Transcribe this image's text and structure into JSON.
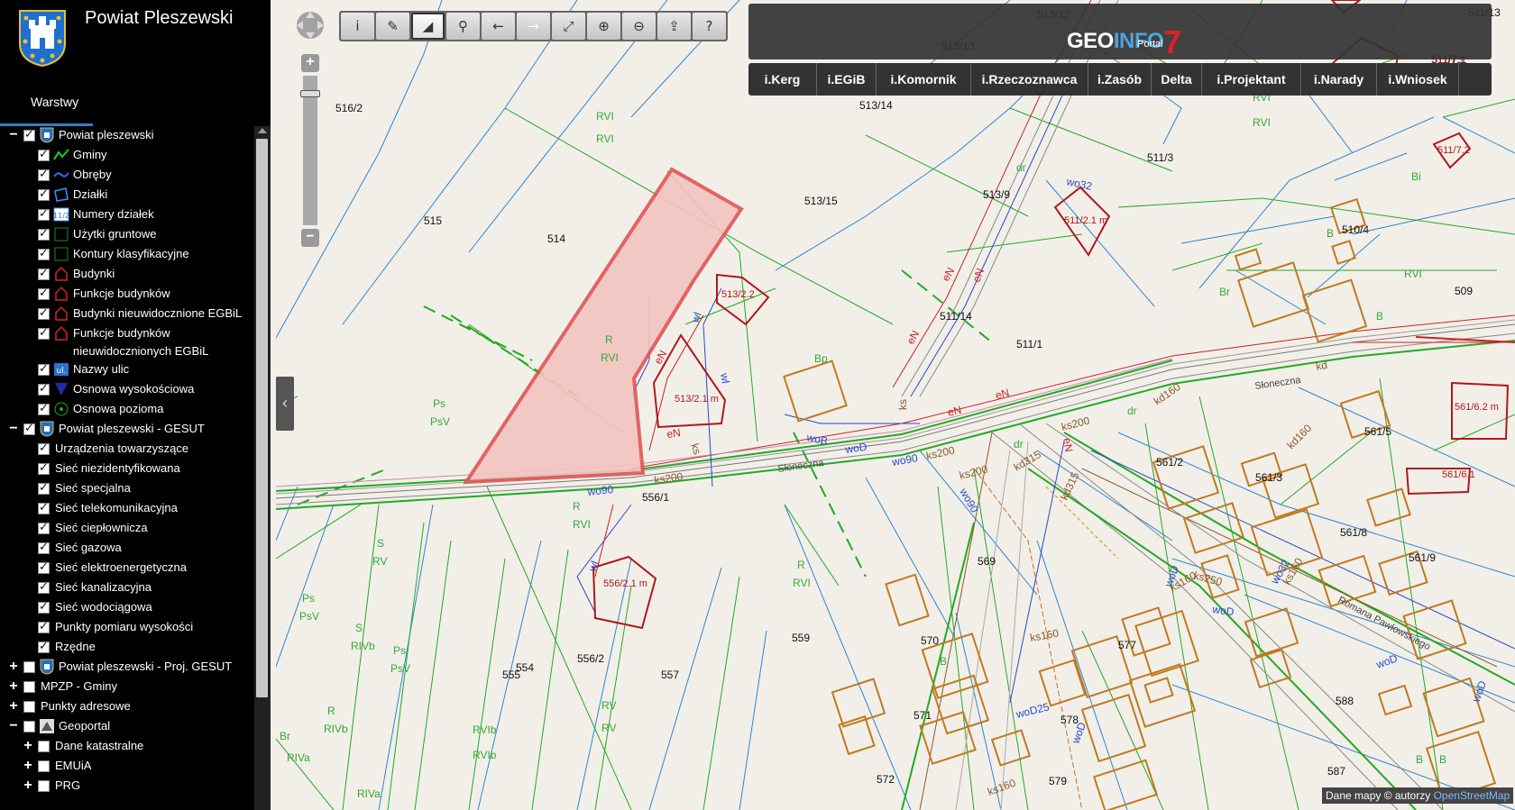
{
  "app": {
    "title": "Powiat Pleszewski"
  },
  "sidebar": {
    "tab_label": "Warstwy",
    "layers": [
      {
        "label": "Powiat pleszewski",
        "level": 0,
        "expander": "−",
        "checked": true,
        "icon": "coat-of-arms-icon"
      },
      {
        "label": "Gminy",
        "level": 1,
        "checked": true,
        "icon": "green-line-icon"
      },
      {
        "label": "Obręby",
        "level": 1,
        "checked": true,
        "icon": "blue-line-icon"
      },
      {
        "label": "Działki",
        "level": 1,
        "checked": true,
        "icon": "parcel-polygon-icon"
      },
      {
        "label": "Numery działek",
        "level": 1,
        "checked": true,
        "icon": "parcel-number-icon"
      },
      {
        "label": "Użytki gruntowe",
        "level": 1,
        "checked": true,
        "icon": "land-use-icon"
      },
      {
        "label": "Kontury klasyfikacyjne",
        "level": 1,
        "checked": true,
        "icon": "contour-icon"
      },
      {
        "label": "Budynki",
        "level": 1,
        "checked": true,
        "icon": "building-icon"
      },
      {
        "label": "Funkcje budynków",
        "level": 1,
        "checked": true,
        "icon": "building-icon"
      },
      {
        "label": "Budynki nieuwidocznione EGBiL",
        "level": 1,
        "checked": true,
        "icon": "building-icon"
      },
      {
        "label": "Funkcje budynków nieuwidocznionych EGBiL",
        "level": 1,
        "checked": true,
        "icon": "building-icon"
      },
      {
        "label": "Nazwy ulic",
        "level": 1,
        "checked": true,
        "icon": "street-name-icon"
      },
      {
        "label": "Osnowa wysokościowa",
        "level": 1,
        "checked": true,
        "icon": "triangle-icon"
      },
      {
        "label": "Osnowa pozioma",
        "level": 1,
        "checked": true,
        "icon": "circle-point-icon"
      },
      {
        "label": "Powiat pleszewski - GESUT",
        "level": 0,
        "expander": "−",
        "checked": true,
        "icon": "coat-of-arms-icon"
      },
      {
        "label": "Urządzenia towarzyszące",
        "level": 1,
        "checked": true,
        "icon": ""
      },
      {
        "label": "Sieć niezidentyfikowana",
        "level": 1,
        "checked": true,
        "icon": ""
      },
      {
        "label": "Sieć specjalna",
        "level": 1,
        "checked": true,
        "icon": ""
      },
      {
        "label": "Sieć telekomunikacyjna",
        "level": 1,
        "checked": true,
        "icon": ""
      },
      {
        "label": "Sieć ciepłownicza",
        "level": 1,
        "checked": true,
        "icon": ""
      },
      {
        "label": "Sieć gazowa",
        "level": 1,
        "checked": true,
        "icon": ""
      },
      {
        "label": "Sieć elektroenergetyczna",
        "level": 1,
        "checked": true,
        "icon": ""
      },
      {
        "label": "Sieć kanalizacyjna",
        "level": 1,
        "checked": true,
        "icon": ""
      },
      {
        "label": "Sieć wodociągowa",
        "level": 1,
        "checked": true,
        "icon": ""
      },
      {
        "label": "Punkty pomiaru wysokości",
        "level": 1,
        "checked": true,
        "icon": ""
      },
      {
        "label": "Rzędne",
        "level": 1,
        "checked": true,
        "icon": ""
      },
      {
        "label": "Powiat pleszewski - Proj. GESUT",
        "level": 0,
        "expander": "+",
        "checked": false,
        "icon": "coat-of-arms-icon"
      },
      {
        "label": "MPZP - Gminy",
        "level": 0,
        "expander": "+",
        "checked": false,
        "icon": ""
      },
      {
        "label": "Punkty adresowe",
        "level": 0,
        "expander": "+",
        "checked": false,
        "icon": ""
      },
      {
        "label": "Geoportal",
        "level": 0,
        "expander": "−",
        "checked": false,
        "icon": "geoportal-icon"
      },
      {
        "label": "Dane katastralne",
        "level": 1,
        "expander": "+",
        "checked": false,
        "icon": ""
      },
      {
        "label": "EMUiA",
        "level": 1,
        "expander": "+",
        "checked": false,
        "icon": ""
      },
      {
        "label": "PRG",
        "level": 1,
        "expander": "+",
        "checked": false,
        "icon": ""
      }
    ]
  },
  "toolbar": {
    "buttons": [
      {
        "name": "info-button",
        "glyph": "i",
        "state": "normal"
      },
      {
        "name": "measure-length-button",
        "glyph": "✎",
        "state": "normal"
      },
      {
        "name": "measure-area-button",
        "glyph": "◢",
        "state": "active"
      },
      {
        "name": "search-button",
        "glyph": "⚲",
        "state": "normal"
      },
      {
        "name": "back-button",
        "glyph": "←",
        "state": "normal"
      },
      {
        "name": "forward-button",
        "glyph": "→",
        "state": "disabled"
      },
      {
        "name": "full-extent-button",
        "glyph": "⤢",
        "state": "normal"
      },
      {
        "name": "zoom-in-button",
        "glyph": "⊕",
        "state": "normal"
      },
      {
        "name": "zoom-out-button",
        "glyph": "⊖",
        "state": "normal"
      },
      {
        "name": "share-button",
        "glyph": "⇪",
        "state": "normal"
      },
      {
        "name": "help-button",
        "glyph": "?",
        "state": "normal"
      }
    ]
  },
  "zoom": {
    "in_label": "+",
    "out_label": "−"
  },
  "geoinfo": {
    "logo_geo": "GEO",
    "logo_info": "INFO",
    "logo_seven": "7",
    "portal_label": "Portal"
  },
  "modules": [
    {
      "label": "i.Kerg"
    },
    {
      "label": "i.EGiB"
    },
    {
      "label": "i.Komornik"
    },
    {
      "label": "i.Rzeczoznawca"
    },
    {
      "label": "i.Zasób"
    },
    {
      "label": "Delta"
    },
    {
      "label": "i.Projektant"
    },
    {
      "label": "i.Narady"
    },
    {
      "label": "i.Wniosek"
    }
  ],
  "attribution": {
    "text": "Dane mapy © autorzy ",
    "link": "OpenStreetMap"
  },
  "colors": {
    "selection_fill": "#f2c4c0",
    "selection_stroke": "#e05555",
    "building": "#c07a20",
    "building_red": "#b01818",
    "land": "#22aa22",
    "parcel": "#2b86d0"
  },
  "map": {
    "parcel_labels": [
      "516/2",
      "515",
      "514",
      "513/15",
      "513/14",
      "513/13",
      "513/9",
      "511/14",
      "511/1",
      "511/3",
      "510/4",
      "509",
      "556/1",
      "556/2",
      "554",
      "555",
      "557",
      "559",
      "569",
      "570",
      "571",
      "572",
      "577",
      "578",
      "579",
      "561/2",
      "561/3",
      "561/5",
      "561/8",
      "561/9",
      "588",
      "587",
      "511/7.1",
      "513/12",
      "511/13"
    ],
    "land_labels": [
      "RVI",
      "RVI",
      "R",
      "RVI",
      "Ps",
      "PsV",
      "S",
      "RV",
      "Ps",
      "PsV",
      "S",
      "RIVb",
      "Ps",
      "PsV",
      "R",
      "RIVb",
      "RVIb",
      "RVIb",
      "RV",
      "RV",
      "R",
      "RVI",
      "RIVa",
      "RIVa",
      "Br",
      "B",
      "B",
      "Bp",
      "Br",
      "RVI",
      "RVI",
      "RVI",
      "Bi",
      "dr",
      "dr",
      "dr",
      "B",
      "B",
      "B",
      "R",
      "RVI"
    ],
    "building_labels": [
      "513/2.2",
      "513/2.1\nm",
      "511/2.1\nm",
      "556/2.1\nm",
      "561/6.2\nm",
      "561/6.1",
      "511/7.2",
      "511/7.1"
    ],
    "street_labels": [
      "Słoneczna",
      "Słoneczna",
      "Romana Pawłowskiego"
    ],
    "utility_labels": [
      "ks200",
      "ks200",
      "ks200",
      "ks200",
      "wo90",
      "wo90",
      "wo90",
      "woB",
      "woD",
      "woD",
      "woD",
      "woD",
      "woD",
      "woD",
      "woD25",
      "ks160",
      "ks160",
      "ks160",
      "ks160",
      "kd315",
      "kd160",
      "kd160",
      "kd315",
      "eN",
      "eN",
      "eN",
      "eN",
      "eN",
      "eN",
      "eN",
      "eN",
      "wo32",
      "wo32",
      "ks250",
      "kd",
      "wl",
      "wl",
      "wl",
      "ks",
      "ks",
      "woB"
    ]
  }
}
